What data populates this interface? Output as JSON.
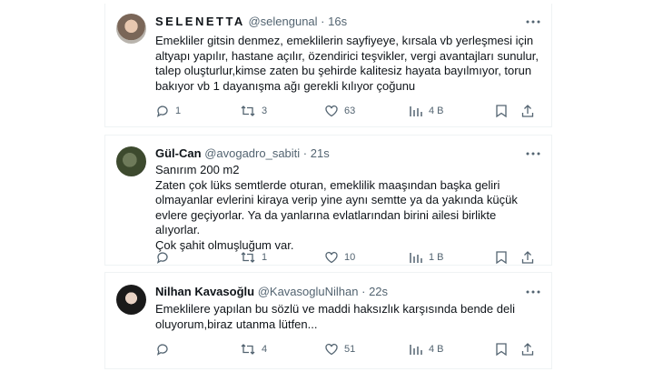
{
  "tweets": [
    {
      "display_name": "SELENETTA",
      "handle": "@selengunal",
      "separator": "·",
      "time": "16s",
      "text": "Emekliler gitsin denmez, emeklilerin sayfiyeye, kırsala vb yerleşmesi için\naltyapı yapılır, hastane açılır, özendirici teşvikler, vergi avantajları sunulur,\ntalep oluşturlur,kimse zaten bu şehirde kalitesiz hayata bayılmıyor, torun\nbakıyor vb 1 dayanışma ağı gerekli kılıyor çoğunu",
      "replies": "1",
      "retweets": "3",
      "likes": "63",
      "views": "4 B"
    },
    {
      "display_name": "Gül-Can",
      "handle": "@avogadro_sabiti",
      "separator": "·",
      "time": "21s",
      "text": "Sanırım 200 m2\nZaten çok lüks semtlerde oturan, emeklilik maaşından başka geliri\nolmayanlar evlerini kiraya verip yine aynı semtte ya da yakında küçük\nevlere geçiyorlar. Ya da yanlarına evlatlarından birini ailesi birlikte alıyorlar.\nÇok şahit olmuşluğum var.",
      "replies": "",
      "retweets": "1",
      "likes": "10",
      "views": "1 B"
    },
    {
      "display_name": "Nilhan Kavasoğlu",
      "handle": "@KavasogluNilhan",
      "separator": "·",
      "time": "22s",
      "text": "Emeklilere yapılan bu sözlü ve maddi haksızlık karşısında bende deli\noluyorum,biraz utanma lütfen...",
      "replies": "",
      "retweets": "4",
      "likes": "51",
      "views": "4 B"
    }
  ],
  "icons": [
    "avatar",
    "more-icon",
    "reply-icon",
    "retweet-icon",
    "like-icon",
    "views-icon",
    "bookmark-icon",
    "share-icon"
  ],
  "colors": {
    "text": "#0f1419",
    "secondary": "#536471",
    "border": "#eff3f4"
  }
}
